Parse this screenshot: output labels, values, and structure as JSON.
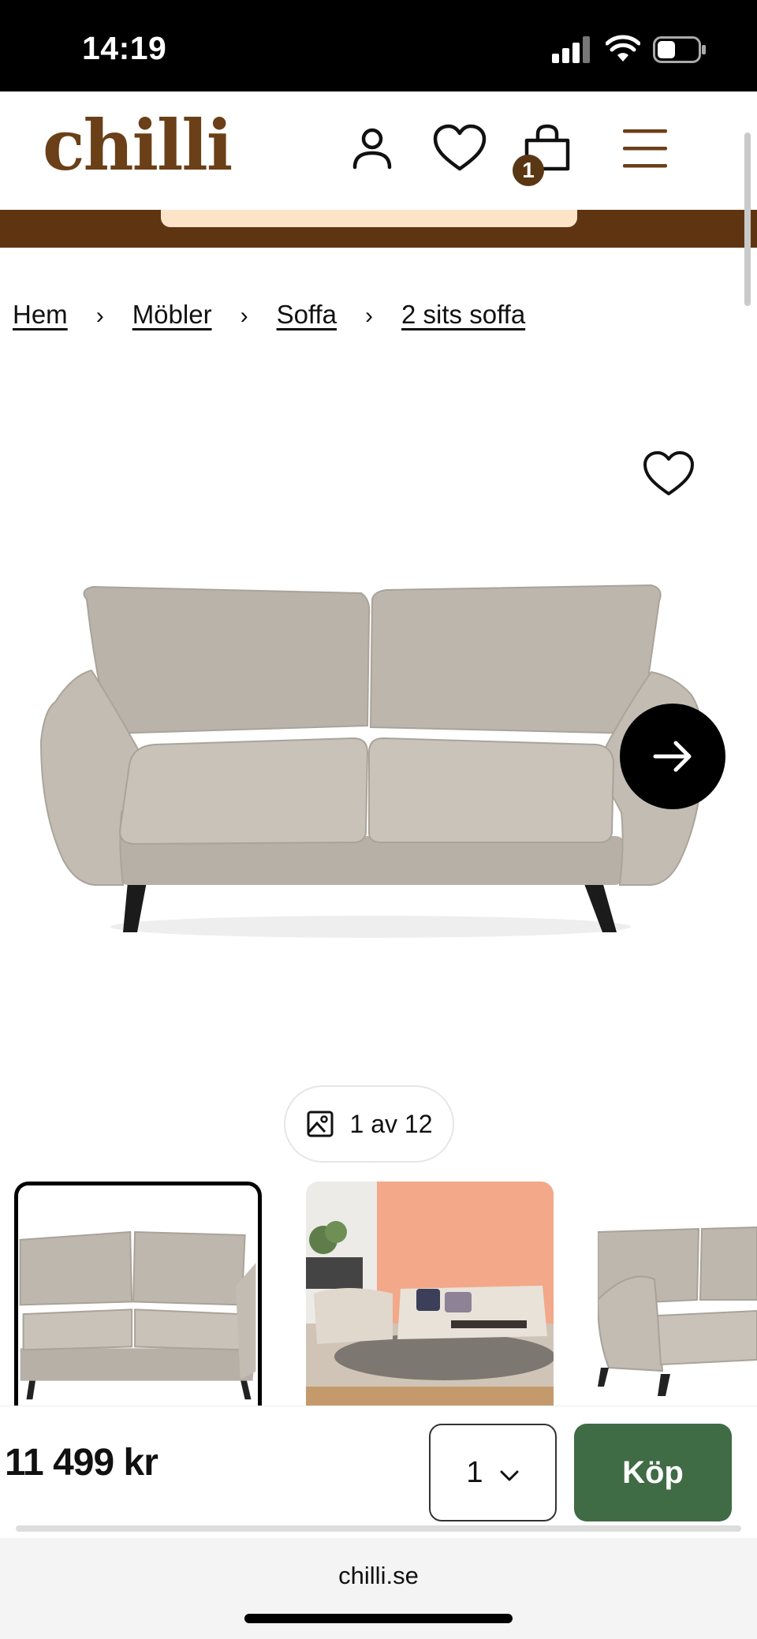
{
  "status_bar": {
    "time": "14:19"
  },
  "header": {
    "logo": "chilli",
    "cart_count": "1"
  },
  "breadcrumb": {
    "items": [
      "Hem",
      "Möbler",
      "Soffa",
      "2 sits soffa"
    ],
    "separator": "›"
  },
  "gallery": {
    "counter": "1 av 12"
  },
  "buy_bar": {
    "price": "11 499 kr",
    "quantity": "1",
    "buy_label": "Köp"
  },
  "browser": {
    "url": "chilli.se"
  },
  "colors": {
    "brand_brown": "#6b3f17",
    "band_brown": "#5f3511",
    "buy_green": "#3f6b45",
    "promo_peach": "#fde4c8"
  }
}
